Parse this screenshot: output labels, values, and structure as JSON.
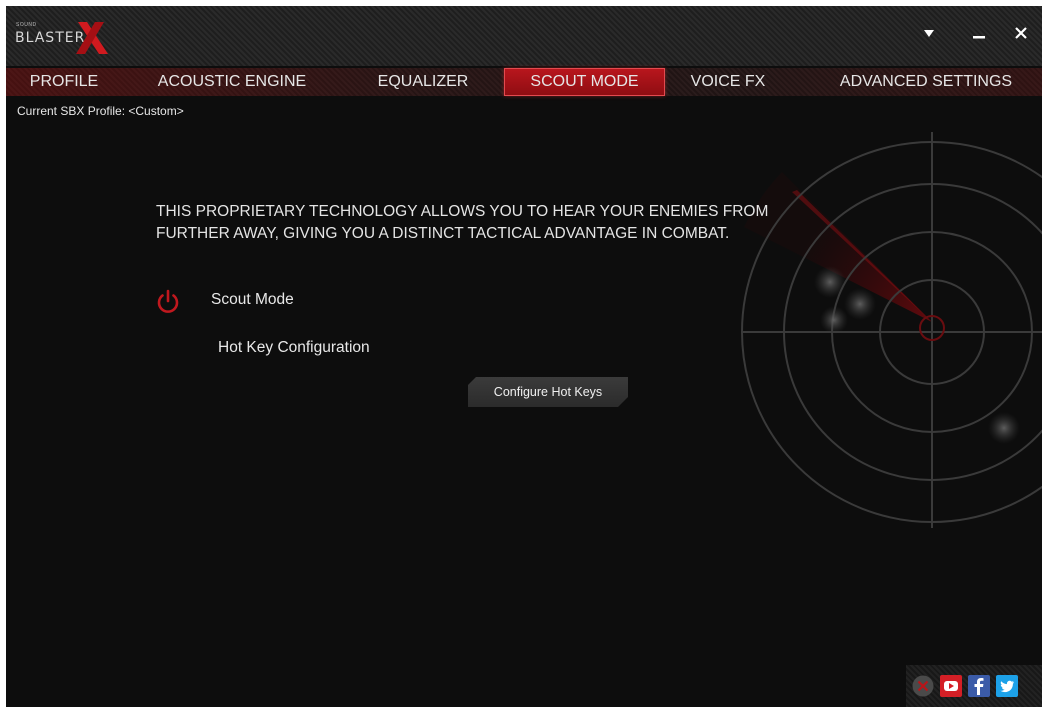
{
  "app": {
    "logo_small": "SOUND",
    "logo_word": "BLASTER"
  },
  "window_controls": {
    "menu": "dropdown-arrow-icon",
    "minimize": "minimize-icon",
    "close": "close-icon"
  },
  "tabs": [
    {
      "label": "PROFILE",
      "active": false
    },
    {
      "label": "ACOUSTIC ENGINE",
      "active": false
    },
    {
      "label": "EQUALIZER",
      "active": false
    },
    {
      "label": "SCOUT MODE",
      "active": true
    },
    {
      "label": "VOICE FX",
      "active": false
    },
    {
      "label": "ADVANCED SETTINGS",
      "active": false
    }
  ],
  "profile": {
    "text": "Current SBX Profile: <Custom>"
  },
  "scout": {
    "description_line1": "THIS PROPRIETARY TECHNOLOGY ALLOWS YOU TO HEAR YOUR ENEMIES FROM",
    "description_line2": "FURTHER AWAY, GIVING YOU A DISTINCT TACTICAL ADVANTAGE IN COMBAT.",
    "toggle_label": "Scout Mode",
    "toggle_icon": "power-icon",
    "hotkey_label": "Hot Key Configuration",
    "configure_button": "Configure Hot Keys"
  },
  "social": {
    "items": [
      "x-circle-icon",
      "youtube-icon",
      "facebook-icon",
      "twitter-icon"
    ]
  },
  "colors": {
    "accent": "#b8161d",
    "background": "#0d0d0d",
    "text": "#e6e6e6"
  }
}
